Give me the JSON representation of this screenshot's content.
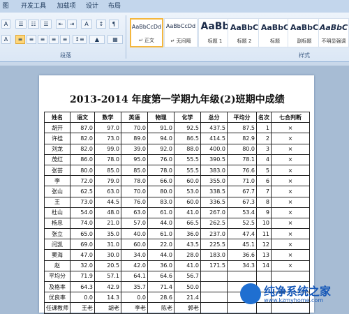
{
  "ribbon": {
    "tabs": [
      "图",
      "开发工具",
      "加载项",
      "设计",
      "布局"
    ],
    "groups": {
      "paragraph": "段落",
      "styles": "样式"
    },
    "styles": [
      {
        "preview": "AaBbCcDd",
        "name": "↵ 正文"
      },
      {
        "preview": "AaBbCcDd",
        "name": "↵ 无间隔"
      },
      {
        "preview": "AaBb",
        "name": "标题 1"
      },
      {
        "preview": "AaBbC",
        "name": "标题 2"
      },
      {
        "preview": "AaBbC",
        "name": "标题"
      },
      {
        "preview": "AaBbC",
        "name": "副标题"
      },
      {
        "preview": "AaBbC",
        "name": "不明显强调"
      }
    ]
  },
  "document": {
    "title": "2013-2014 年度第一学期九年级(2)班期中成绩",
    "headers": [
      "姓名",
      "语文",
      "数学",
      "英语",
      "物理",
      "化学",
      "总分",
      "平均分",
      "名次",
      "七合判断"
    ],
    "rows": [
      [
        "胡开",
        "87.0",
        "97.0",
        "70.0",
        "91.0",
        "92.5",
        "437.5",
        "87.5",
        "1",
        "×"
      ],
      [
        "许桂",
        "82.0",
        "73.0",
        "89.0",
        "94.0",
        "86.5",
        "414.5",
        "82.9",
        "2",
        "×"
      ],
      [
        "刘龙",
        "82.0",
        "99.0",
        "39.0",
        "92.0",
        "88.0",
        "400.0",
        "80.0",
        "3",
        "×"
      ],
      [
        "茂红",
        "86.0",
        "78.0",
        "95.0",
        "76.0",
        "55.5",
        "390.5",
        "78.1",
        "4",
        "×"
      ],
      [
        "张芸",
        "80.0",
        "85.0",
        "85.0",
        "78.0",
        "55.5",
        "383.0",
        "76.6",
        "5",
        "×"
      ],
      [
        "李",
        "72.0",
        "79.0",
        "78.0",
        "66.0",
        "60.0",
        "355.0",
        "71.0",
        "6",
        "×"
      ],
      [
        "张山",
        "62.5",
        "63.0",
        "70.0",
        "80.0",
        "53.0",
        "338.5",
        "67.7",
        "7",
        "×"
      ],
      [
        "王",
        "73.0",
        "44.5",
        "76.0",
        "83.0",
        "60.0",
        "336.5",
        "67.3",
        "8",
        "×"
      ],
      [
        "杜山",
        "54.0",
        "48.0",
        "63.0",
        "61.0",
        "41.0",
        "267.0",
        "53.4",
        "9",
        "×"
      ],
      [
        "杨忠",
        "74.0",
        "21.0",
        "57.0",
        "44.0",
        "66.5",
        "262.5",
        "52.5",
        "10",
        "×"
      ],
      [
        "张立",
        "65.0",
        "35.0",
        "40.0",
        "61.0",
        "36.0",
        "237.0",
        "47.4",
        "11",
        "×"
      ],
      [
        "闫凯",
        "69.0",
        "31.0",
        "60.0",
        "22.0",
        "43.5",
        "225.5",
        "45.1",
        "12",
        "×"
      ],
      [
        "窦海",
        "47.0",
        "30.0",
        "34.0",
        "44.0",
        "28.0",
        "183.0",
        "36.6",
        "13",
        "×"
      ],
      [
        "赵",
        "32.0",
        "20.5",
        "42.0",
        "36.0",
        "41.0",
        "171.5",
        "34.3",
        "14",
        "×"
      ],
      [
        "平均分",
        "71.9",
        "57.1",
        "64.1",
        "64.6",
        "56.7",
        "",
        "",
        "",
        ""
      ],
      [
        "及格率",
        "64.3",
        "42.9",
        "35.7",
        "71.4",
        "50.0",
        "",
        "",
        "",
        ""
      ],
      [
        "优良率",
        "0.0",
        "14.3",
        "0.0",
        "28.6",
        "21.4",
        "",
        "",
        "",
        ""
      ],
      [
        "任课教师",
        "王老",
        "胡老",
        "李老",
        "陈老",
        "郭老",
        "",
        "",
        "",
        ""
      ]
    ]
  },
  "watermark": {
    "text": "纯净系统之家",
    "url": "www.kzmyhome.com"
  },
  "colors": {
    "ribbon": "#dbe7f5",
    "tab_bar": "#c3d6ec",
    "workspace": "#a7bcd4",
    "selected_style": "#f4b73e"
  }
}
